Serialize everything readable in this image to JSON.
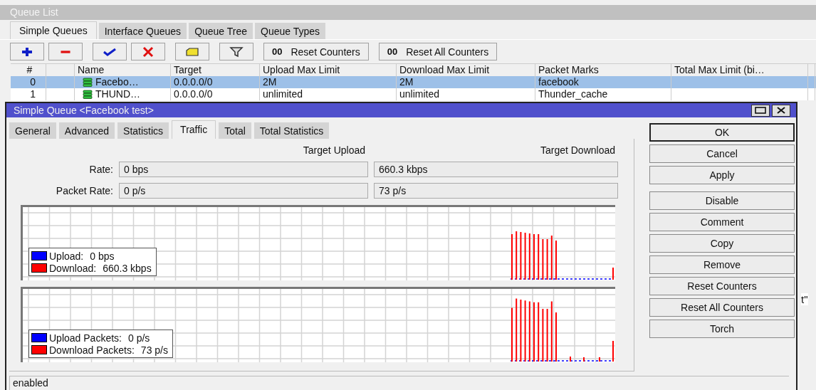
{
  "queue_list": {
    "title": "Queue List",
    "tabs": [
      {
        "label": "Simple Queues",
        "selected": true
      },
      {
        "label": "Interface Queues",
        "selected": false
      },
      {
        "label": "Queue Tree",
        "selected": false
      },
      {
        "label": "Queue Types",
        "selected": false
      }
    ],
    "toolbar": [
      {
        "kind": "add"
      },
      {
        "kind": "remove"
      },
      {
        "kind": "enable"
      },
      {
        "kind": "disable"
      },
      {
        "kind": "comment"
      },
      {
        "kind": "filter"
      },
      {
        "kind": "text",
        "icon": "00",
        "label": "Reset Counters"
      },
      {
        "kind": "text",
        "icon": "00",
        "label": "Reset All Counters"
      }
    ],
    "columns": {
      "number": "#",
      "name": "Name",
      "target": "Target",
      "upload_max_limit": "Upload Max Limit",
      "download_max_limit": "Download Max Limit",
      "packet_marks": "Packet Marks",
      "total_max_limit": "Total Max Limit (bi…"
    },
    "rows": [
      {
        "number": "0",
        "name": "Facebo…",
        "target": "0.0.0.0/0",
        "upload_max_limit": "2M",
        "download_max_limit": "2M",
        "packet_marks": "facebook",
        "selected": true
      },
      {
        "number": "1",
        "name": "THUND…",
        "target": "0.0.0.0/0",
        "upload_max_limit": "unlimited",
        "download_max_limit": "unlimited",
        "packet_marks": "Thunder_cache",
        "selected": false
      }
    ]
  },
  "background_fragment": "t\"",
  "dialog": {
    "title": "Simple Queue <Facebook test>",
    "tabs": [
      {
        "label": "General",
        "selected": false
      },
      {
        "label": "Advanced",
        "selected": false
      },
      {
        "label": "Statistics",
        "selected": false
      },
      {
        "label": "Traffic",
        "selected": true
      },
      {
        "label": "Total",
        "selected": false
      },
      {
        "label": "Total Statistics",
        "selected": false
      }
    ],
    "headers": [
      "Target Upload",
      "Target Download"
    ],
    "stats": [
      {
        "label": "Rate:",
        "upload": "0 bps",
        "download": "660.3 kbps"
      },
      {
        "label": "Packet Rate:",
        "upload": "0 p/s",
        "download": "73 p/s"
      }
    ],
    "graphs": [
      {
        "legend": [
          {
            "label": "Upload:",
            "value": "0 bps",
            "color": "#0000ff"
          },
          {
            "label": "Download:",
            "value": "660.3 kbps",
            "color": "#ff0000"
          }
        ]
      },
      {
        "legend": [
          {
            "label": "Upload Packets:",
            "value": "0 p/s",
            "color": "#0000ff"
          },
          {
            "label": "Download Packets:",
            "value": "73 p/s",
            "color": "#ff0000"
          }
        ]
      }
    ],
    "buttons": [
      {
        "label": "OK",
        "default": true
      },
      {
        "label": "Cancel",
        "default": false
      },
      {
        "label": "Apply",
        "default": false
      },
      {
        "label": "Disable",
        "default": false
      },
      {
        "label": "Comment",
        "default": false
      },
      {
        "label": "Copy",
        "default": false
      },
      {
        "label": "Remove",
        "default": false
      },
      {
        "label": "Reset Counters",
        "default": false
      },
      {
        "label": "Reset All Counters",
        "default": false
      },
      {
        "label": "Torch",
        "default": false
      }
    ],
    "status": "enabled"
  }
}
